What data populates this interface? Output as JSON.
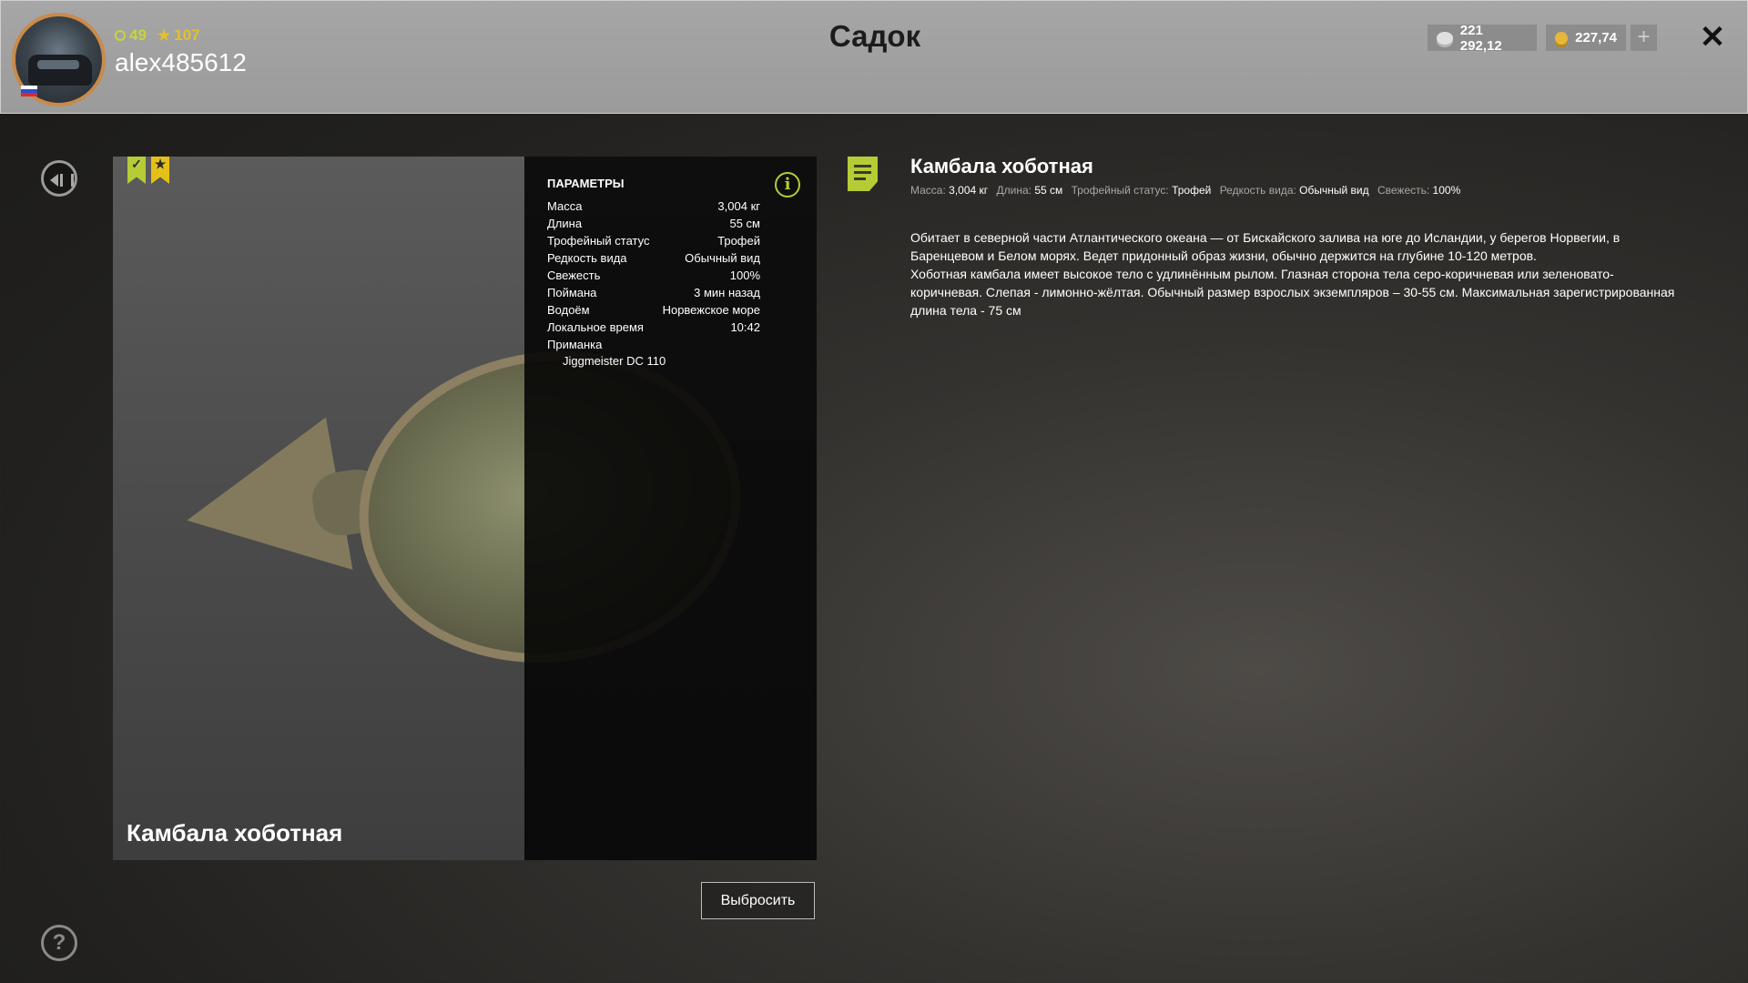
{
  "header": {
    "title": "Садок",
    "player": {
      "username": "alex485612",
      "level": "49",
      "rank": "107"
    },
    "currency": {
      "silver": "221 292,12",
      "gold": "227,74"
    },
    "add_label": "+",
    "close_label": "✕"
  },
  "left_nav": {
    "help_label": "?"
  },
  "fish": {
    "name": "Камбала хоботная",
    "badges": [
      {
        "name": "trophy-check",
        "mark": "✓",
        "color": "#b6cc36"
      },
      {
        "name": "favorite-star",
        "mark": "★",
        "color": "#e5c018"
      }
    ],
    "params": {
      "title": "ПАРАМЕТРЫ",
      "rows": [
        {
          "label": "Масса",
          "value": "3,004 кг"
        },
        {
          "label": "Длина",
          "value": "55 см"
        },
        {
          "label": "Трофейный статус",
          "value": "Трофей"
        },
        {
          "label": "Редкость вида",
          "value": "Обычный вид"
        },
        {
          "label": "Свежесть",
          "value": "100%"
        },
        {
          "label": "Поймана",
          "value": "3 мин назад"
        },
        {
          "label": "Водоём",
          "value": "Норвежское море"
        },
        {
          "label": "Локальное время",
          "value": "10:42"
        }
      ],
      "bait_label": "Приманка",
      "bait_value": "Jiggmeister DC 110",
      "info_label": "i"
    },
    "discard_label": "Выбросить"
  },
  "description": {
    "title": "Камбала хоботная",
    "meta": [
      {
        "label": "Масса:",
        "value": "3,004 кг"
      },
      {
        "label": "Длина:",
        "value": "55 см"
      },
      {
        "label": "Трофейный статус:",
        "value": "Трофей"
      },
      {
        "label": "Редкость вида:",
        "value": "Обычный вид"
      },
      {
        "label": "Свежесть:",
        "value": "100%"
      }
    ],
    "paragraph1": "Обитает в северной части Атлантического океана — от Бискайского залива на юге до Исландии, у берегов Норвегии, в Баренцевом и Белом морях. Ведет придонный образ жизни, обычно держится на глубине 10-120 метров.",
    "paragraph2": "Хоботная камбала имеет высокое тело с удлинённым рылом. Глазная сторона тела серо-коричневая или зеленовато-коричневая. Слепая - лимонно-жёлтая. Обычный размер взрослых экземпляров – 30-55 см. Максимальная зарегистрированная длина тела - 75 см"
  },
  "colors": {
    "accent": "#b6cc36",
    "gold": "#e5c018",
    "header_bg": "#a6a6a6",
    "avatar_ring": "#c98a4a"
  }
}
